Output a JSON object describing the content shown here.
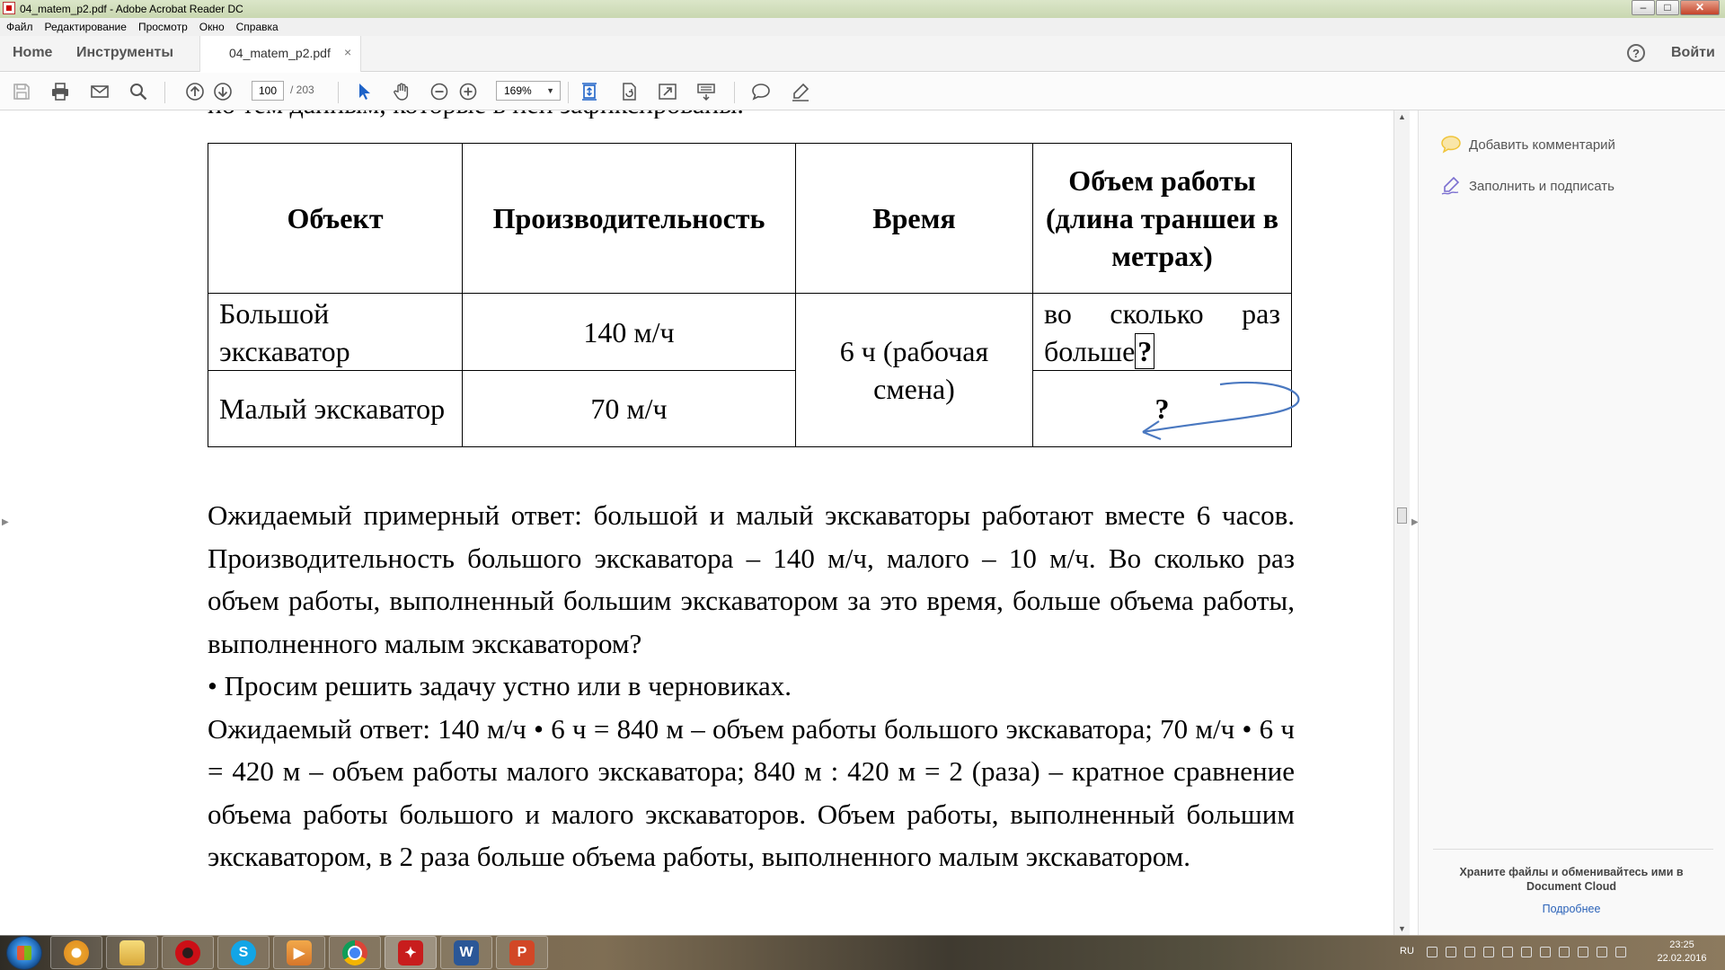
{
  "window": {
    "title": "04_matem_p2.pdf - Adobe Acrobat Reader DC",
    "minimize": "–",
    "maximize": "□",
    "close": "✕"
  },
  "menu": [
    "Файл",
    "Редактирование",
    "Просмотр",
    "Окно",
    "Справка"
  ],
  "tabs": {
    "home": "Home",
    "tools": "Инструменты",
    "doc_tab": "04_matem_p2.pdf",
    "doc_tab_close": "×",
    "help": "?",
    "signin": "Войти"
  },
  "toolbar": {
    "page_current": "100",
    "page_total": "/ 203",
    "zoom": "169%",
    "icons": [
      "save-icon",
      "print-icon",
      "email-icon",
      "search-icon",
      "page-up-icon",
      "page-down-icon",
      "select-cursor-icon",
      "hand-icon",
      "zoom-out-icon",
      "zoom-in-icon",
      "fit-page-icon",
      "rotate-icon",
      "full-screen-icon",
      "scroll-mode-icon",
      "comment-icon",
      "sign-icon"
    ]
  },
  "document": {
    "cut_line": "по тем данным, которые в ней зафиксированы.",
    "table": {
      "headers": [
        "Объект",
        "Производительность",
        "Время",
        "Объем работы (длина траншеи в метрах)"
      ],
      "rows": [
        {
          "object": "Большой экскаватор",
          "productivity": "140 м/ч",
          "volume": "во сколько раз больше",
          "volume_mark": "?"
        },
        {
          "object": "Малый экскаватор",
          "productivity": "70 м/ч",
          "volume": "?"
        }
      ],
      "time_merged": "6 ч (рабочая смена)"
    },
    "paragraphs": [
      "Ожидаемый примерный ответ: большой и малый экскаваторы работают вместе 6 часов. Производительность большого экскаватора – 140 м/ч, малого – 10 м/ч. Во сколько раз объем работы, выполненный большим экскаватором за это время, больше объема работы, выполненного малым экскаватором?",
      "• Просим решить задачу устно или в черновиках.",
      "Ожидаемый ответ: 140 м/ч • 6 ч = 840 м – объем работы большого экскаватора; 70 м/ч • 6 ч = 420 м – объем работы малого экскаватора; 840 м : 420 м = 2 (раза) – кратное сравнение объема работы большого и малого экскаваторов. Объем работы, выполненный большим экскаватором, в 2 раза больше объема работы, выполненного малым экскаватором."
    ]
  },
  "right_panel": {
    "add_comment": "Добавить комментарий",
    "fill_sign": "Заполнить и подписать",
    "cloud_text": "Храните файлы и обменивайтесь ими в Document Cloud",
    "more": "Подробнее"
  },
  "taskbar": {
    "apps": [
      "chrome-canary",
      "file-explorer",
      "opera",
      "skype",
      "media-player",
      "chrome",
      "acrobat-reader",
      "word",
      "powerpoint"
    ],
    "lang": "RU",
    "time": "23:25",
    "date": "22.02.2016"
  },
  "colors": {
    "acrobat_blue": "#2a62b8",
    "annotation_arrow": "#4a78c0",
    "acrobat_red": "#c81d1d",
    "word_blue": "#2b5797",
    "ppt_orange": "#d24726"
  }
}
